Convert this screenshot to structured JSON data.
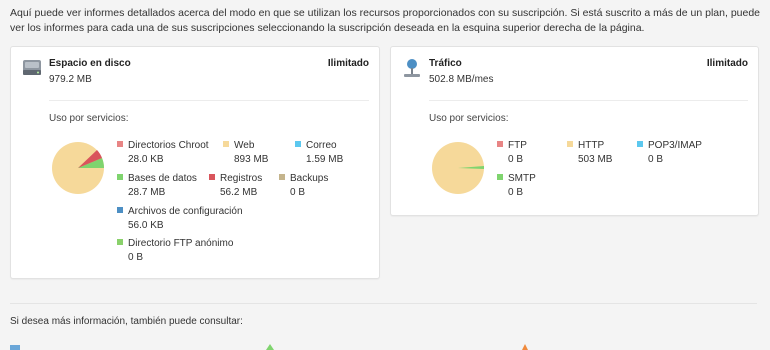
{
  "intro_text": "Aquí puede ver informes detallados acerca del modo en que se utilizan los recursos proporcionados con su suscripción. Si está suscrito a más de un plan, puede ver los informes para cada una de sus suscripciones seleccionando la suscripción deseada en la esquina superior derecha de la página.",
  "disk": {
    "title": "Espacio en disco",
    "value": "979.2 MB",
    "limit": "Ilimitado",
    "usage_label": "Uso por servicios:",
    "icon": "hard-drive-icon",
    "items": [
      {
        "name": "Directorios Chroot",
        "value": "28.0 KB",
        "color": "#e88585"
      },
      {
        "name": "Web",
        "value": "893 MB",
        "color": "#f6d99a"
      },
      {
        "name": "Correo",
        "value": "1.59 MB",
        "color": "#5cc8ef"
      },
      {
        "name": "Bases de datos",
        "value": "28.7 MB",
        "color": "#7fd46e"
      },
      {
        "name": "Registros",
        "value": "56.2 MB",
        "color": "#d9555c"
      },
      {
        "name": "Backups",
        "value": "0 B",
        "color": "#c4b48c"
      },
      {
        "name": "Archivos de configuración",
        "value": "56.0 KB",
        "color": "#4d8fc4"
      },
      {
        "name": "Directorio FTP anónimo",
        "value": "0 B",
        "color": "#8ad16b"
      }
    ]
  },
  "traffic": {
    "title": "Tráfico",
    "value": "502.8 MB/mes",
    "limit": "Ilimitado",
    "usage_label": "Uso por servicios:",
    "icon": "network-traffic-icon",
    "items": [
      {
        "name": "FTP",
        "value": "0 B",
        "color": "#e88585"
      },
      {
        "name": "HTTP",
        "value": "503 MB",
        "color": "#f6d99a"
      },
      {
        "name": "POP3/IMAP",
        "value": "0 B",
        "color": "#5cc8ef"
      },
      {
        "name": "SMTP",
        "value": "0 B",
        "color": "#7fd46e"
      }
    ]
  },
  "more_info": "Si desea más información, también puede consultar:"
}
